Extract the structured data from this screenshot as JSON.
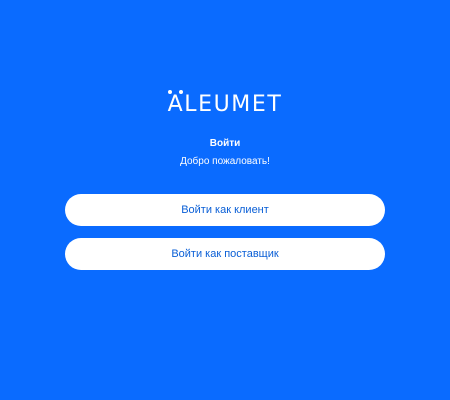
{
  "logo": {
    "first_letter": "A",
    "rest": "LEUMET"
  },
  "login": {
    "title": "Войти",
    "subtitle": "Добро пожаловать!",
    "client_button": "Войти как клиент",
    "supplier_button": "Войти как поставщик"
  },
  "colors": {
    "background": "#0a6bff",
    "button_bg": "#ffffff",
    "button_text": "#0a5fd6"
  }
}
